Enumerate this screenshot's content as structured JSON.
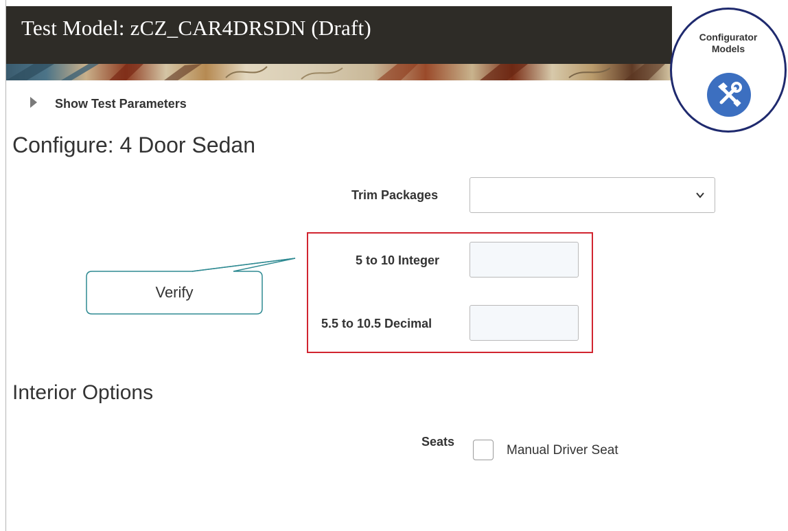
{
  "header": {
    "title": "Test Model: zCZ_CAR4DRSDN (Draft)"
  },
  "badge": {
    "label_line1": "Configurator",
    "label_line2": "Models",
    "icon": "tools-icon",
    "icon_color": "#3c6fc0",
    "ring_color": "#1f2a6e"
  },
  "test_parameters": {
    "toggle_label": "Show Test Parameters"
  },
  "configure": {
    "heading": "Configure: 4 Door Sedan",
    "fields": {
      "trim_packages": {
        "label": "Trim Packages",
        "value": ""
      },
      "integer_field": {
        "label": "5 to 10 Integer",
        "value": ""
      },
      "decimal_field": {
        "label": "5.5 to 10.5 Decimal",
        "value": ""
      }
    }
  },
  "callout": {
    "text": "Verify",
    "border_color": "#2f8a92",
    "highlight_color": "#d1242f"
  },
  "interior": {
    "heading": "Interior Options",
    "seats": {
      "label": "Seats",
      "option_label": "Manual Driver Seat",
      "checked": false
    }
  }
}
